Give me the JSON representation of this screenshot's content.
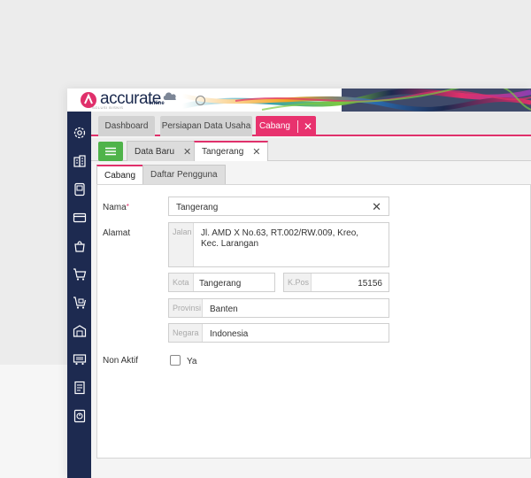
{
  "app": {
    "logo_text": "accurate",
    "logo_online": "online",
    "logo_sub": "SOLUSI BISNIS",
    "brand_color": "#e0306b"
  },
  "main_tabs": [
    {
      "label": "Dashboard"
    },
    {
      "label": "Persiapan Data Usaha"
    },
    {
      "label": "Cabang",
      "close": "✕"
    }
  ],
  "sub_tabs": [
    {
      "label": "Data Baru",
      "close": "✕"
    },
    {
      "label": "Tangerang",
      "close": "✕"
    }
  ],
  "inner_tabs": [
    {
      "label": "Cabang"
    },
    {
      "label": "Daftar Pengguna"
    }
  ],
  "form": {
    "nama_label": "Nama",
    "nama_required": "*",
    "nama_value": "Tangerang",
    "nama_clear": "✕",
    "alamat_label": "Alamat",
    "jalan_prefix": "Jalan",
    "jalan_line1": "Jl. AMD X No.63, RT.002/RW.009, Kreo,",
    "jalan_line2": "Kec. Larangan",
    "kota_prefix": "Kota",
    "kota_value": "Tangerang",
    "kpos_prefix": "K.Pos",
    "kpos_value": "15156",
    "provinsi_prefix": "Provinsi",
    "provinsi_value": "Banten",
    "negara_prefix": "Negara",
    "negara_value": "Indonesia",
    "nonaktif_label": "Non Aktif",
    "nonaktif_option": "Ya"
  },
  "sidebar_icons": [
    "gear-icon",
    "building-icon",
    "phone-icon",
    "card-icon",
    "bag-icon",
    "cart-icon",
    "cart-box-icon",
    "warehouse-icon",
    "truck-icon",
    "document-icon",
    "report-icon"
  ]
}
